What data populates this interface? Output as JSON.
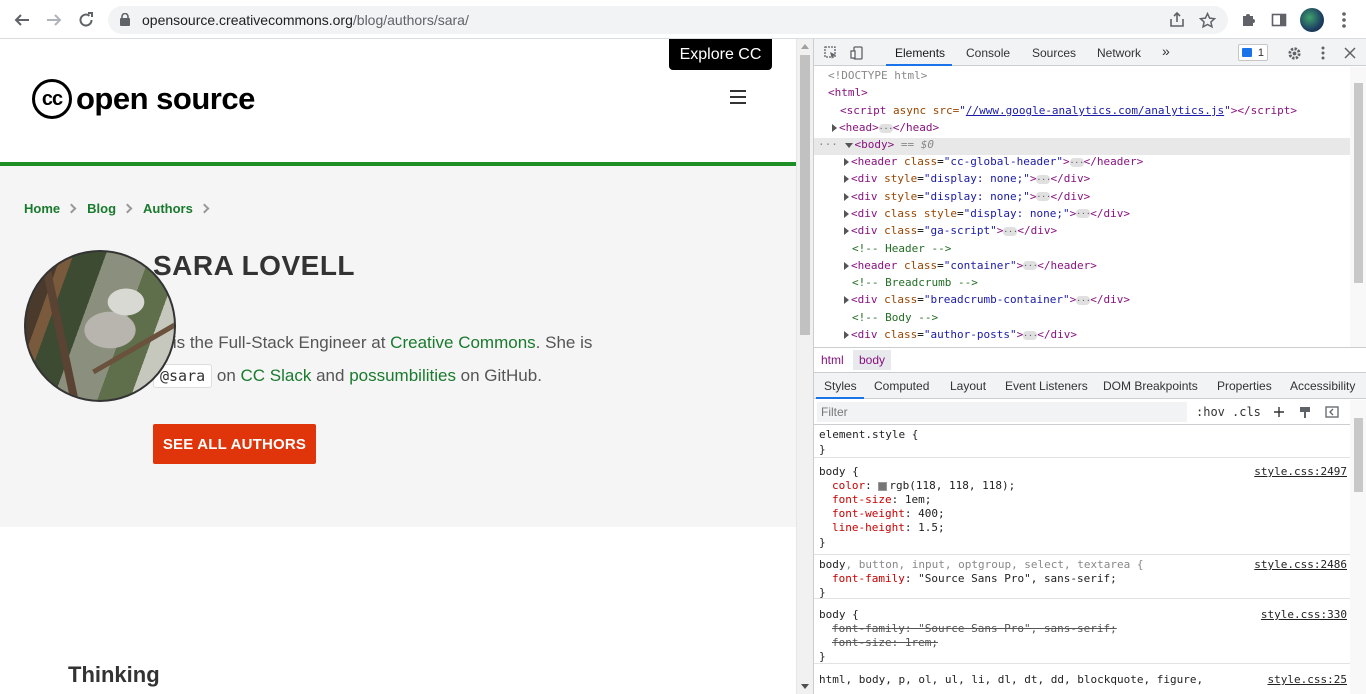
{
  "browser": {
    "url_host": "opensource.creativecommons.org",
    "url_path": "/blog/authors/sara/"
  },
  "site": {
    "explore_label": "Explore CC",
    "logo_mark": "cc",
    "logo_text": "open source"
  },
  "breadcrumb": [
    "Home",
    "Blog",
    "Authors"
  ],
  "author": {
    "name": "SARA LOVELL",
    "bio_part1": "ra is the Full-Stack Engineer at ",
    "bio_link1": "Creative Commons",
    "bio_part2": ". She is",
    "handle": "@sara",
    "bio_part3": " on ",
    "bio_link2": "CC Slack",
    "bio_part4": " and ",
    "bio_link3": "possumbilities",
    "bio_part5": " on GitHub."
  },
  "see_all_label": "SEE ALL AUTHORS",
  "section_heading": "Thinking",
  "devtools": {
    "tabs": [
      "Elements",
      "Console",
      "Sources",
      "Network"
    ],
    "more_tabs": "»",
    "issue_count": "1",
    "dom": {
      "doctype": "<!DOCTYPE html>",
      "html_open": "<html>",
      "script_attr": "async src=",
      "script_src": "//www.google-analytics.com/analytics.js",
      "head": "head",
      "body": "body",
      "body_marker": "== $0",
      "nodes": [
        {
          "tag": "header",
          "attr": "class",
          "val": "cc-global-header"
        },
        {
          "tag": "div",
          "attr": "style",
          "val": "display: none;"
        },
        {
          "tag": "div",
          "attr": "style",
          "val": "display: none;"
        },
        {
          "tag": "div",
          "attr": "class style",
          "val": "display: none;"
        },
        {
          "tag": "div",
          "attr": "class",
          "val": "ga-script"
        },
        {
          "comment": "<!-- Header -->"
        },
        {
          "tag": "header",
          "attr": "class",
          "val": "container"
        },
        {
          "comment": "<!-- Breadcrumb -->"
        },
        {
          "tag": "div",
          "attr": "class",
          "val": "breadcrumb-container"
        },
        {
          "comment": "<!-- Body -->"
        },
        {
          "tag": "div",
          "attr": "class",
          "val": "author-posts"
        }
      ]
    },
    "crumbs": [
      "html",
      "body"
    ],
    "style_tabs": [
      "Styles",
      "Computed",
      "Layout",
      "Event Listeners",
      "DOM Breakpoints",
      "Properties",
      "Accessibility"
    ],
    "filter_placeholder": "Filter",
    "hov": ":hov",
    "cls": ".cls",
    "rules": {
      "element_style": "element.style {",
      "close": "}",
      "r1_selector": "body {",
      "r1_src": "style.css:2497",
      "r1_color_prop": "color",
      "r1_color_val": "rgb(118, 118, 118);",
      "r1_fs_prop": "font-size",
      "r1_fs_val": "1em;",
      "r1_fw_prop": "font-weight",
      "r1_fw_val": "400;",
      "r1_lh_prop": "line-height",
      "r1_lh_val": "1.5;",
      "r2_selector_main": "body",
      "r2_selector_rest": ", button, input, optgroup, select, textarea {",
      "r2_src": "style.css:2486",
      "r2_ff_prop": "font-family",
      "r2_ff_val": "\"Source Sans Pro\", sans-serif;",
      "r3_selector": "body {",
      "r3_src": "style.css:330",
      "r3_ff_line": "font-family: \"Source Sans Pro\", sans-serif;",
      "r3_fs_line": "font-size: 1rem;",
      "r4_selector": "html, body, p, ol, ul, li, dl, dt, dd, blockquote, figure,",
      "r4_src": "style.css:25"
    }
  }
}
